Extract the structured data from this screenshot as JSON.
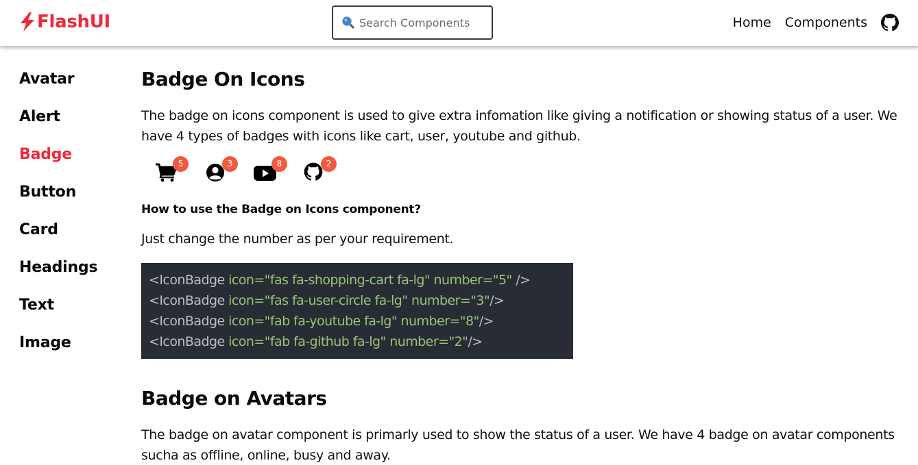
{
  "brand": {
    "name": "FlashUI",
    "icon": "lightning-bolt-icon",
    "color": "#ee2a3b"
  },
  "search": {
    "icon": "magnifier-icon",
    "placeholder": "Search Components",
    "value": ""
  },
  "nav": {
    "items": [
      {
        "label": "Home"
      },
      {
        "label": "Components"
      }
    ],
    "github_icon": "github-icon"
  },
  "sidebar": {
    "items": [
      {
        "label": "Avatar",
        "active": false
      },
      {
        "label": "Alert",
        "active": false
      },
      {
        "label": "Badge",
        "active": true
      },
      {
        "label": "Button",
        "active": false
      },
      {
        "label": "Card",
        "active": false
      },
      {
        "label": "Headings",
        "active": false
      },
      {
        "label": "Text",
        "active": false
      },
      {
        "label": "Image",
        "active": false
      }
    ]
  },
  "main": {
    "section1": {
      "title": "Badge On Icons",
      "description": "The badge on icons component is used to give extra infomation like giving a notification or showing status of a user. We have 4 types of badges with icons like cart, user, youtube and github.",
      "icon_badges": [
        {
          "icon": "shopping-cart-icon",
          "number": "5"
        },
        {
          "icon": "user-circle-icon",
          "number": "3"
        },
        {
          "icon": "youtube-icon",
          "number": "8"
        },
        {
          "icon": "github-icon",
          "number": "2"
        }
      ],
      "badge_color": "#f25a3f",
      "howto_title": "How to use the Badge on Icons component?",
      "howto_text": "Just change the number as per your requirement.",
      "code_lines": [
        {
          "tag": "<IconBadge ",
          "attrs": "icon=\"fas fa-shopping-cart fa-lg\" number=\"5\"",
          "close": " />"
        },
        {
          "tag": "<IconBadge ",
          "attrs": "icon=\"fas fa-user-circle fa-lg\" number=\"3\"",
          "close": "/>"
        },
        {
          "tag": "<IconBadge ",
          "attrs": "icon=\"fab fa-youtube fa-lg\" number=\"8\"",
          "close": "/>"
        },
        {
          "tag": "<IconBadge ",
          "attrs": "icon=\"fab fa-github fa-lg\" number=\"2\"",
          "close": "/>"
        }
      ]
    },
    "section2": {
      "title": "Badge on Avatars",
      "description": "The badge on avatar component is primarly used to show the status of a user. We have 4 badge on avatar components sucha as offline, online, busy and away."
    }
  }
}
